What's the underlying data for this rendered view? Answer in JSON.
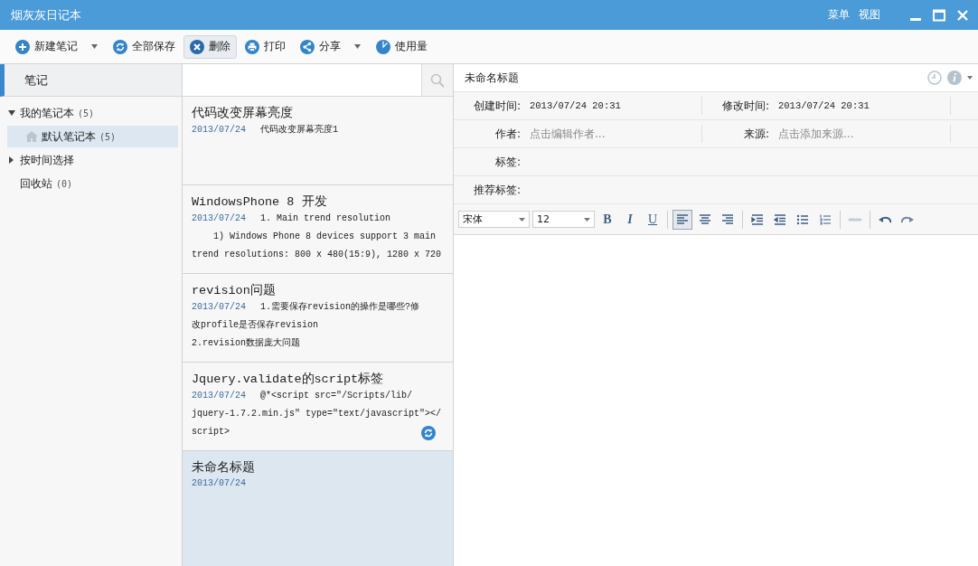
{
  "window": {
    "title": "烟灰灰日记本",
    "menu_items": [
      "菜单",
      "视图"
    ]
  },
  "toolbar": [
    {
      "label": "新建笔记",
      "dropdown": true,
      "highlighted": false
    },
    {
      "label": "全部保存",
      "dropdown": false,
      "highlighted": false
    },
    {
      "label": "删除",
      "dropdown": false,
      "highlighted": true
    },
    {
      "label": "打印",
      "dropdown": false,
      "highlighted": false
    },
    {
      "label": "分享",
      "dropdown": true,
      "highlighted": false
    },
    {
      "label": "使用量",
      "dropdown": false,
      "highlighted": false
    }
  ],
  "sidebar": {
    "header": "笔记",
    "items": [
      {
        "label": "我的笔记本",
        "count": "(5)",
        "expanded": true,
        "selected": false,
        "children": [
          {
            "label": "默认笔记本",
            "count": "(5)",
            "selected": true
          }
        ]
      },
      {
        "label": "按时间选择",
        "expanded": false,
        "selected": false
      },
      {
        "label": "回收站",
        "count": "(0)",
        "selected": false
      }
    ]
  },
  "notes": [
    {
      "title": "代码改变屏幕亮度",
      "date": "2013/07/24",
      "lines": [
        {
          "text": "代码改变屏幕亮度1",
          "indent": false
        }
      ],
      "syncing": false,
      "selected": false
    },
    {
      "title": "WindowsPhone 8 开发",
      "date": "2013/07/24",
      "lines": [
        {
          "text": "1. Main trend resolution",
          "indent": false
        },
        {
          "text": "1) Windows Phone 8 devices support 3 main",
          "indent": true
        },
        {
          "text": "trend resolutions: 800 x 480(15:9), 1280 x 720",
          "indent": false
        }
      ],
      "syncing": false,
      "selected": false
    },
    {
      "title": "revision问题",
      "date": "2013/07/24",
      "lines": [
        {
          "text": "1.需要保存revision的操作是哪些?修",
          "indent": false
        },
        {
          "text": "改profile是否保存revision",
          "indent": false
        },
        {
          "text": "2.revision数据庞大问题",
          "indent": false
        }
      ],
      "syncing": false,
      "selected": false
    },
    {
      "title": "Jquery.validate的script标签",
      "date": "2013/07/24",
      "lines": [
        {
          "text": "@*<script src=\"/Scripts/lib/",
          "indent": false
        },
        {
          "text": "jquery-1.7.2.min.js\" type=\"text/javascript\"></",
          "indent": false
        },
        {
          "text": "script>",
          "indent": false
        }
      ],
      "syncing": true,
      "selected": false
    },
    {
      "title": "未命名标题",
      "date": "2013/07/24",
      "syncing": false,
      "selected": true
    }
  ],
  "editor": {
    "title": "未命名标题",
    "meta": [
      {
        "label": "创建时间:",
        "value": "2013/07/24 20:31"
      },
      {
        "label": "修改时间:",
        "value": "2013/07/24 20:31"
      },
      {
        "label": "作者:",
        "placeholder": "点击编辑作者..."
      },
      {
        "label": "来源:",
        "placeholder": "点击添加来源..."
      }
    ],
    "tag_rows": [
      {
        "label": "标签:"
      },
      {
        "label": "推荐标签:"
      }
    ],
    "font": "宋体",
    "size": "12",
    "styles": [
      "B",
      "I",
      "U"
    ],
    "align": [
      {
        "selected": true
      },
      {
        "selected": false
      },
      {
        "selected": false
      }
    ],
    "link": {
      "disabled": true
    }
  }
}
